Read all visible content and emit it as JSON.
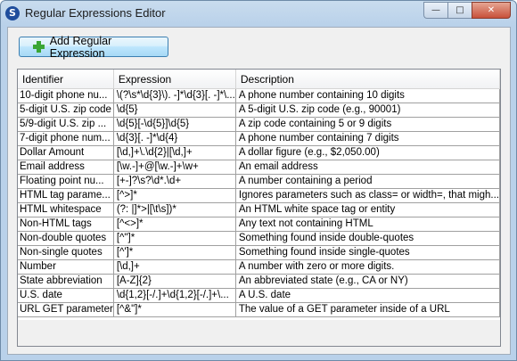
{
  "window": {
    "title": "Regular Expressions Editor",
    "icon": "app-icon"
  },
  "toolbar": {
    "add_label": "Add Regular Expression",
    "add_icon": "plus-icon"
  },
  "table": {
    "columns": [
      "Identifier",
      "Expression",
      "Description"
    ],
    "rows": [
      [
        "10-digit phone nu...",
        "\\(?\\s*\\d{3}\\). -]*\\d{3}[. -]*\\...",
        "A phone number containing 10 digits"
      ],
      [
        "5-digit U.S. zip code",
        "\\d{5}",
        "A 5-digit U.S. zip code (e.g., 90001)"
      ],
      [
        "5/9-digit U.S. zip ...",
        "\\d{5}[-\\d{5}]\\d{5}",
        "A zip code containing 5 or 9 digits"
      ],
      [
        "7-digit phone num...",
        "\\d{3}[. -]*\\d{4}",
        "A phone number containing 7 digits"
      ],
      [
        "Dollar Amount",
        "[\\d,]+\\.\\d{2}|[\\d,]+",
        "A dollar figure (e.g., $2,050.00)"
      ],
      [
        "Email address",
        "[\\w.-]+@[\\w.-]+\\w+",
        "An email address"
      ],
      [
        "Floating point nu...",
        "[+-]?\\s?\\d*.\\d+",
        "A number containing a period"
      ],
      [
        "HTML tag parame...",
        "[^>]*",
        "Ignores parameters such as class= or width=, that migh..."
      ],
      [
        "HTML whitespace",
        "(?: |]*>|[\\t\\s])*",
        "An HTML white space tag or entity"
      ],
      [
        "Non-HTML tags",
        "[^<>]*",
        "Any text not containing HTML"
      ],
      [
        "Non-double quotes",
        "[^\"]*",
        "Something found inside double-quotes"
      ],
      [
        "Non-single quotes",
        "[^']*",
        "Something found inside single-quotes"
      ],
      [
        "Number",
        "[\\d,]+",
        "A number with zero or more digits."
      ],
      [
        "State abbreviation",
        "[A-Z]{2}",
        "An abbreviated state (e.g., CA or NY)"
      ],
      [
        "U.S. date",
        "\\d{1,2}[-/.]+\\d{1,2}[-/.]+\\...",
        "A U.S. date"
      ],
      [
        "URL GET parameter",
        "[^&\"]*",
        "The value of a GET parameter inside of a URL"
      ]
    ]
  }
}
